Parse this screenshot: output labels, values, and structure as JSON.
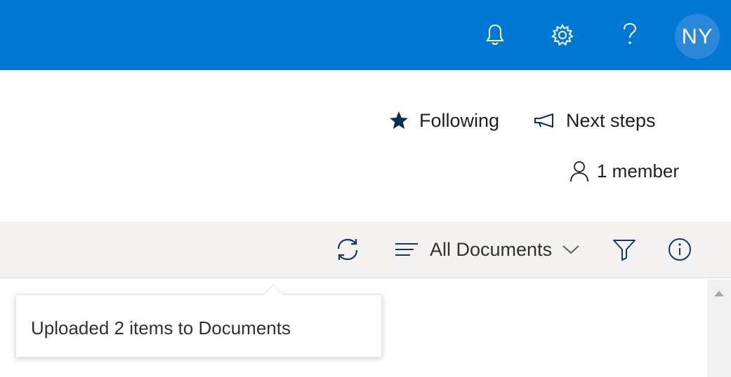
{
  "topbar": {
    "background": "#0078d4",
    "icons": [
      "bell-icon",
      "gear-icon",
      "help-icon"
    ],
    "avatar_initials": "NY"
  },
  "header": {
    "following_label": "Following",
    "next_steps_label": "Next steps",
    "members_label": "1 member"
  },
  "commandbar": {
    "view_label": "All Documents"
  },
  "callout": {
    "message": "Uploaded 2 items to Documents"
  }
}
